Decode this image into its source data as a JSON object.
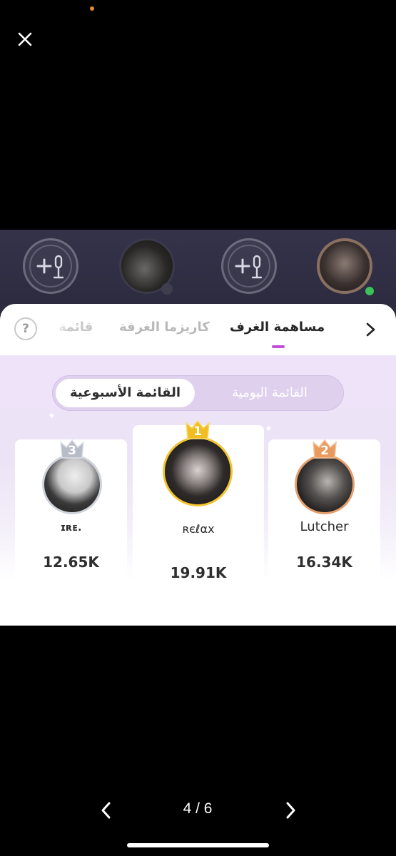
{
  "viewer": {
    "pager": {
      "current": "4 / 6"
    }
  },
  "room": {
    "seats": [
      {
        "type": "empty",
        "icon": "add-mic-icon"
      },
      {
        "type": "occupied"
      },
      {
        "type": "empty",
        "icon": "add-mic-icon"
      },
      {
        "type": "occupied",
        "badge": "mic-icon"
      }
    ]
  },
  "ranking": {
    "tabs": {
      "contribution": "مساهمة الغرف",
      "charisma": "كاريزما الغرفة",
      "list": "قائمة"
    },
    "help_icon": "?",
    "period": {
      "weekly": "القائمة الأسبوعية",
      "daily": "القائمة اليومية"
    },
    "podium": [
      {
        "rank": "1",
        "name": "ʀєℓαx",
        "score": "19.91K"
      },
      {
        "rank": "2",
        "name": "Lutcher",
        "score": "16.34K"
      },
      {
        "rank": "3",
        "name": "ɪʀᴇ.",
        "score": "12.65K"
      }
    ],
    "colors": {
      "gold": "#f3c531",
      "bronze": "#e4a06c",
      "silver": "#cfd3dc",
      "accent": "#c04fd9"
    }
  }
}
